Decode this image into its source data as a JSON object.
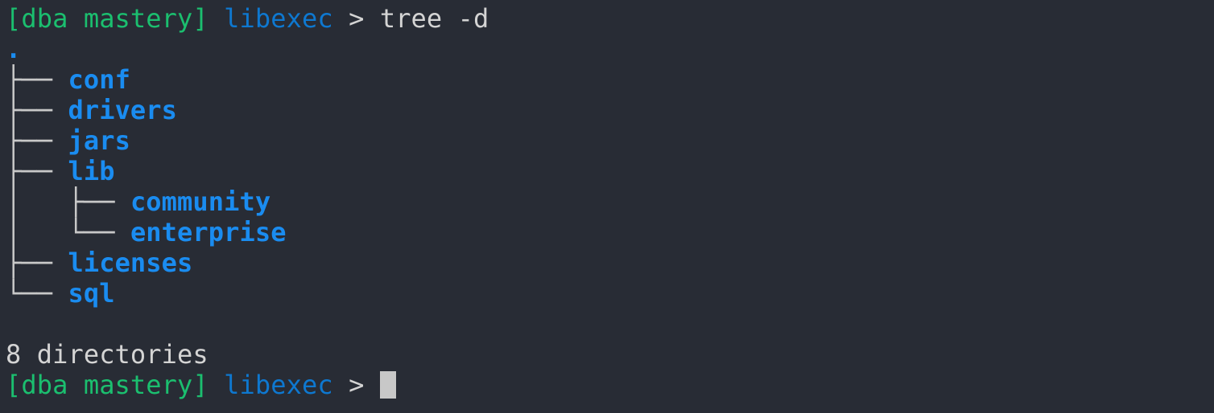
{
  "prompt": {
    "context": "[dba mastery]",
    "cwd": "libexec",
    "symbol": ">"
  },
  "command": "tree -d",
  "root": ".",
  "tree": [
    {
      "branch": "├── ",
      "name": "conf"
    },
    {
      "branch": "├── ",
      "name": "drivers"
    },
    {
      "branch": "├── ",
      "name": "jars"
    },
    {
      "branch": "├── ",
      "name": "lib"
    },
    {
      "branch": "│   ├── ",
      "name": "community"
    },
    {
      "branch": "│   └── ",
      "name": "enterprise"
    },
    {
      "branch": "├── ",
      "name": "licenses"
    },
    {
      "branch": "└── ",
      "name": "sql"
    }
  ],
  "summary": "8 directories",
  "colors": {
    "background": "#282c35",
    "prompt_context": "#1bbf6f",
    "prompt_cwd": "#0e78d0",
    "directory": "#1a8cf0",
    "text": "#d4d4d4"
  }
}
